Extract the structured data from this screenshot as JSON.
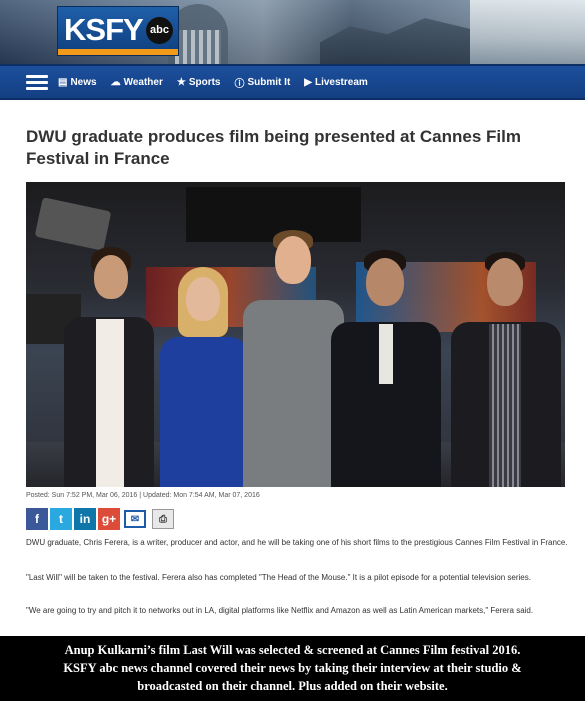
{
  "brand": {
    "logo_text": "KSFY",
    "network_badge": "abc",
    "accent_color": "#f39a1b",
    "primary_color": "#143f83"
  },
  "nav": {
    "menu_icon": "hamburger-icon",
    "items": [
      {
        "label": "News",
        "icon": "newspaper-icon"
      },
      {
        "label": "Weather",
        "icon": "cloud-icon"
      },
      {
        "label": "Sports",
        "icon": "star-icon"
      },
      {
        "label": "Submit It",
        "icon": "info-icon"
      },
      {
        "label": "Livestream",
        "icon": "video-camera-icon"
      }
    ]
  },
  "article": {
    "headline": "DWU graduate produces film being presented at Cannes Film Festival in France",
    "posted": "Posted: Sun 7:52 PM, Mar 06, 2016",
    "updated": "Updated: Mon 7:54 AM, Mar 07, 2016",
    "paragraphs": [
      "DWU graduate, Chris Ferera, is a writer, producer and actor, and he will be taking one of his short films to the prestigious Cannes Film Festival in France.",
      "\"Last Will\" will be taken to the festival. Ferera also has completed \"The Head of the Mouse.\" It is a pilot episode for a potential television series.",
      "\"We are going to try and pitch it to networks out in LA, digital platforms like Netflix and Amazon as well as Latin American markets,\" Ferera said."
    ]
  },
  "share": {
    "facebook": "f",
    "twitter": "t",
    "linkedin": "in",
    "googleplus": "g+",
    "email": "✉",
    "print": "⎙"
  },
  "caption": {
    "lines": [
      "Anup Kulkarni’s film Last Will was selected & screened at Cannes Film festival 2016.",
      "KSFY abc news channel covered their news by taking their interview at their studio &",
      "broadcasted on their channel.  Plus added on their website."
    ]
  }
}
